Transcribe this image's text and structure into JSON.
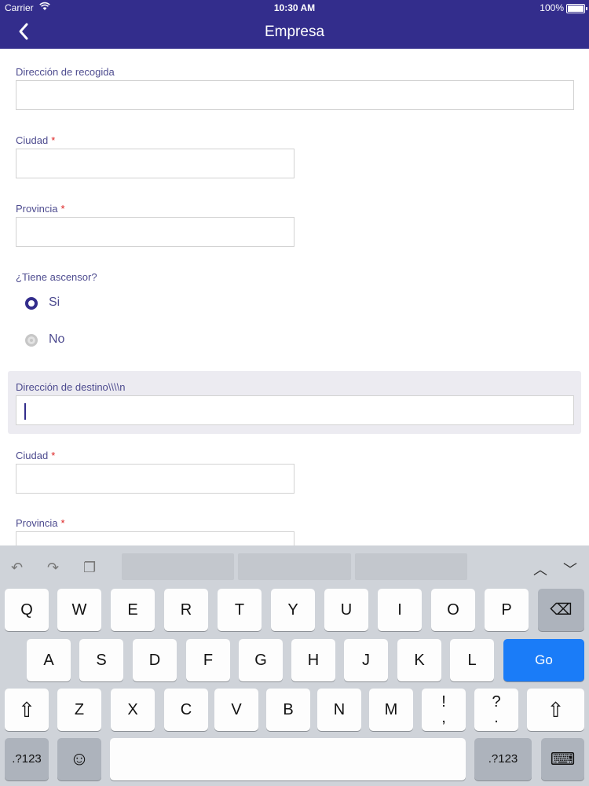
{
  "status": {
    "carrier": "Carrier",
    "time": "10:30 AM",
    "battery": "100%"
  },
  "nav": {
    "title": "Empresa"
  },
  "form": {
    "pickup_label": "Dirección de recogida",
    "city_label": "Ciudad",
    "province_label": "Provincia",
    "elevator_question": "¿Tiene ascensor?",
    "radio_yes": "Si",
    "radio_no": "No",
    "dest_label": "Dirección de destino\\\\\\\\n",
    "dest_city_label": "Ciudad",
    "dest_province_label": "Provincia",
    "required_mark": "*"
  },
  "keyboard": {
    "row1": [
      "Q",
      "W",
      "E",
      "R",
      "T",
      "Y",
      "U",
      "I",
      "O",
      "P"
    ],
    "row2": [
      "A",
      "S",
      "D",
      "F",
      "G",
      "H",
      "J",
      "K",
      "L"
    ],
    "row3": [
      "Z",
      "X",
      "C",
      "V",
      "B",
      "N",
      "M"
    ],
    "exclam": "!",
    "comma": ",",
    "question": "?",
    "period": ".",
    "go": "Go",
    "numbers": ".?123",
    "emoji": "☺",
    "backspace": "⌫",
    "shift": "⇧",
    "hide": "⌨",
    "undo": "↶",
    "redo": "↷",
    "paste": "❐",
    "up": "︿",
    "down": "﹀"
  }
}
